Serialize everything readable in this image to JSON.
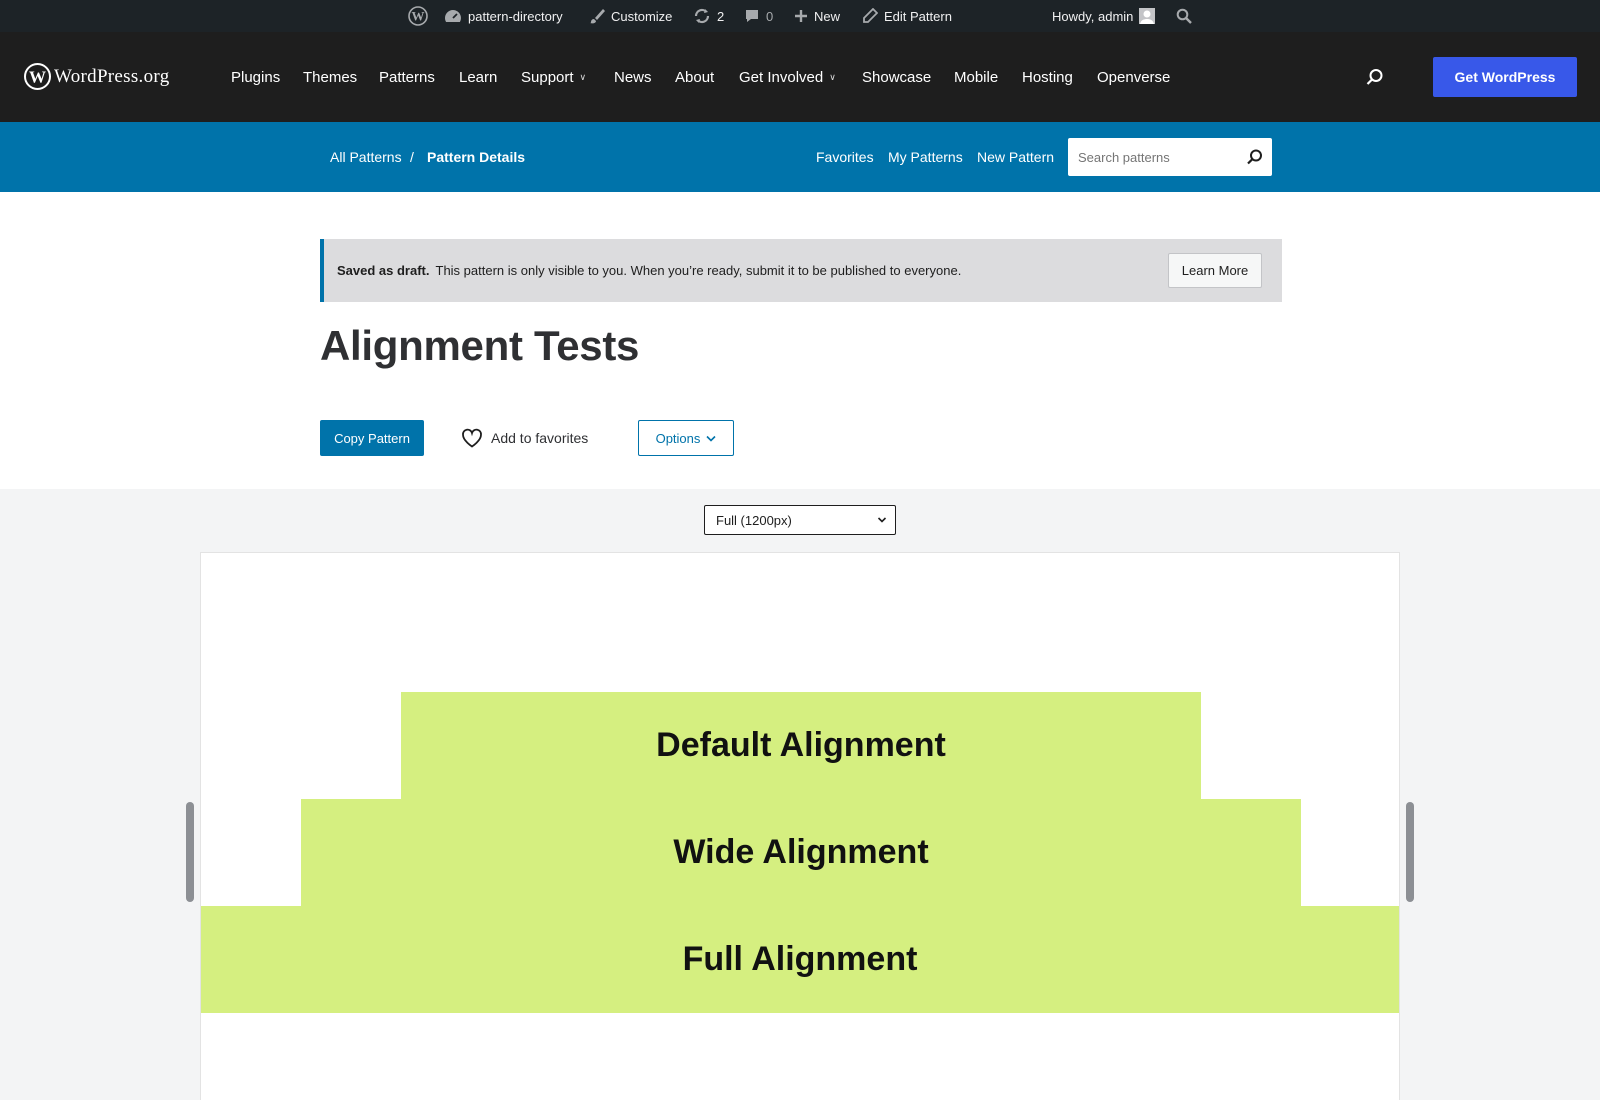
{
  "admin_bar": {
    "site_name": "pattern-directory",
    "customize": "Customize",
    "updates_count": "2",
    "comments_count": "0",
    "new_label": "New",
    "edit_label": "Edit Pattern",
    "howdy": "Howdy, admin"
  },
  "header": {
    "logo_text": "WordPress.org",
    "nav": [
      "Plugins",
      "Themes",
      "Patterns",
      "Learn",
      "Support",
      "News",
      "About",
      "Get Involved",
      "Showcase",
      "Mobile",
      "Hosting",
      "Openverse"
    ],
    "cta": "Get WordPress"
  },
  "local_nav": {
    "breadcrumb_root": "All Patterns",
    "breadcrumb_sep": "/",
    "breadcrumb_current": "Pattern Details",
    "links": [
      "Favorites",
      "My Patterns",
      "New Pattern"
    ],
    "search_placeholder": "Search patterns"
  },
  "notice": {
    "strong": "Saved as draft.",
    "text": "This pattern is only visible to you. When you’re ready, submit it to be published to everyone.",
    "button": "Learn More"
  },
  "pattern": {
    "title": "Alignment Tests",
    "copy_button": "Copy Pattern",
    "favorite_button": "Add to favorites",
    "options_button": "Options"
  },
  "preview": {
    "width_select": "Full (1200px)",
    "blocks": [
      "Default Alignment",
      "Wide Alignment",
      "Full Alignment"
    ]
  },
  "colors": {
    "admin_bar": "#1d2327",
    "header": "#1e1e1e",
    "local_nav": "#0073aa",
    "cta": "#3858e9",
    "block_bg": "#d5ef80"
  }
}
